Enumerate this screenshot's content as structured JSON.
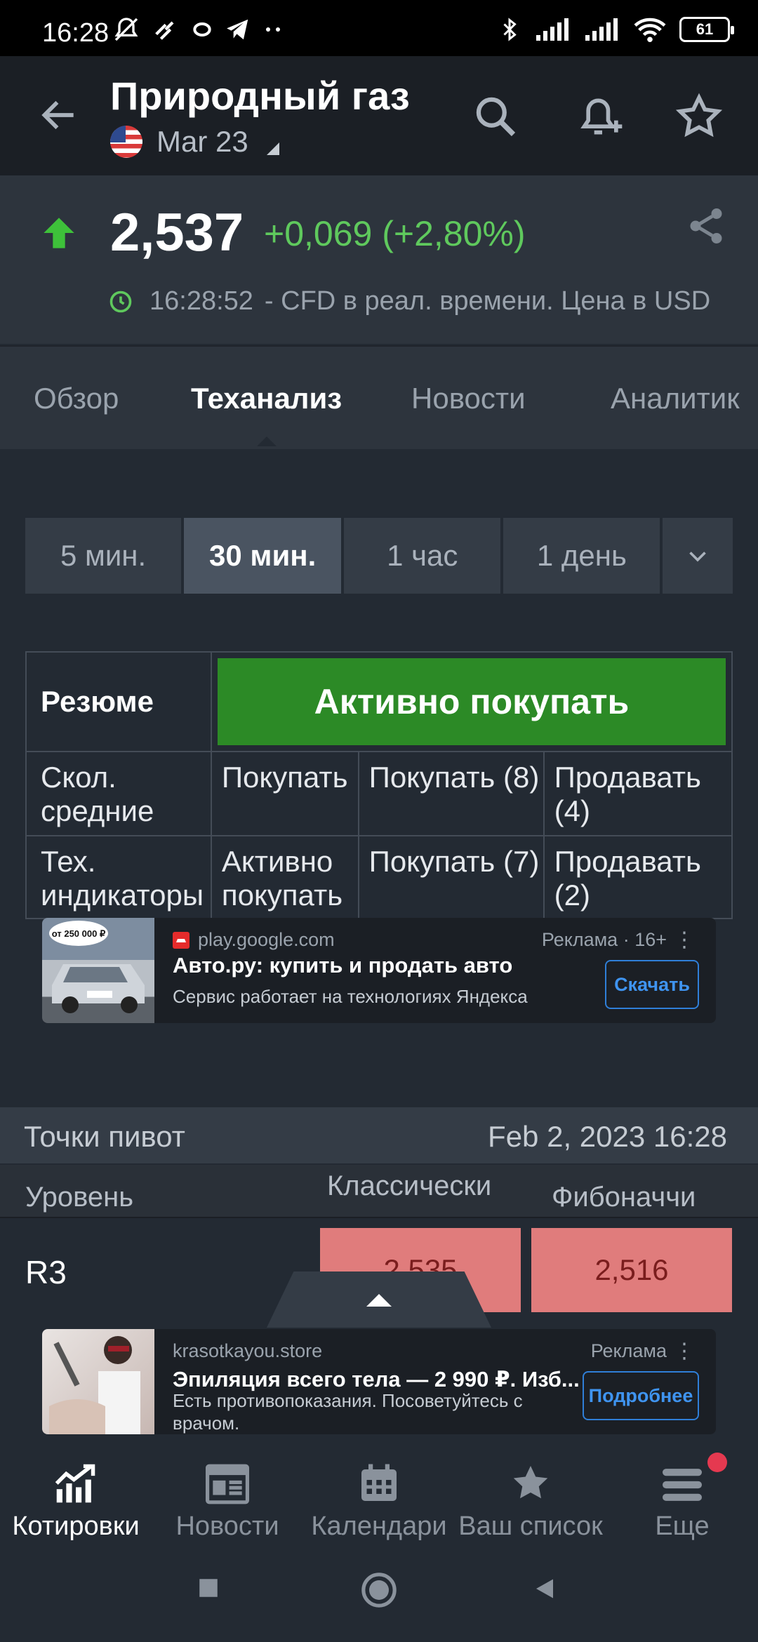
{
  "status": {
    "time": "16:28",
    "battery": "61"
  },
  "header": {
    "title": "Природный газ",
    "contract": "Mar 23"
  },
  "quote": {
    "price": "2,537",
    "change": "+0,069 (+2,80%)",
    "time": "16:28:52",
    "note": "- CFD в реал. времени. Цена в USD",
    "colors": {
      "up": "#5fc95d",
      "bg": "#232a33"
    }
  },
  "tabs": [
    "Обзор",
    "Теханализ",
    "Новости",
    "Аналитик"
  ],
  "timeframes": [
    "5 мин.",
    "30 мин.",
    "1 час",
    "1 день"
  ],
  "summary": {
    "label": "Резюме",
    "verdict": "Активно покупать",
    "rows": [
      {
        "name": "Скол. средние",
        "signal": "Покупать",
        "buy": "Покупать (8)",
        "sell": "Продавать (4)"
      },
      {
        "name": "Тех. индикаторы",
        "signal": "Активно покупать",
        "buy": "Покупать (7)",
        "sell": "Продавать (2)"
      }
    ]
  },
  "ad1": {
    "domain": "play.google.com",
    "tag": "Реклама · 16+",
    "headline": "Авто.ру: купить и продать авто",
    "desc": "Сервис работает на технологиях Яндекса",
    "cta": "Скачать",
    "thumb_text": "от 250 000 ₽"
  },
  "pivot": {
    "title": "Точки пивот",
    "date": "Feb 2, 2023 16:28",
    "cols": {
      "level": "Уровень",
      "classic": "Классически",
      "fib": "Фибоначчи"
    },
    "row": {
      "level": "R3",
      "classic": "2,535",
      "fib": "2,516"
    }
  },
  "ad2": {
    "domain": "krasotkayou.store",
    "tag": "Реклама",
    "headline": "Эпиляция всего тела — 2 990 ₽. Изб...",
    "desc": "Есть противопоказания. Посоветуйтесь с врачом.",
    "cta": "Подробнее"
  },
  "nav": [
    "Котировки",
    "Новости",
    "Календари",
    "Ваш список",
    "Еще"
  ]
}
